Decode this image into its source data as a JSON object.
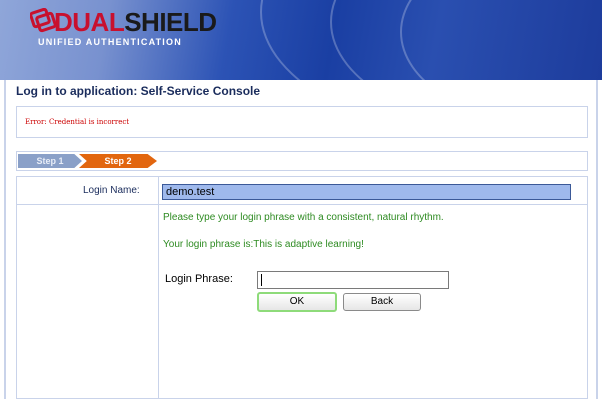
{
  "header": {
    "brand_red": "DUAL",
    "brand_dark": "SHIELD",
    "tagline": "UNIFIED AUTHENTICATION",
    "brand_color": "#c8102e"
  },
  "page_title": "Log in to application: Self-Service Console",
  "error": "Error: Credential is incorrect",
  "steps": [
    {
      "label": "Step 1",
      "state": "done"
    },
    {
      "label": "Step 2",
      "state": "active"
    }
  ],
  "form": {
    "login_name_label": "Login Name:",
    "login_name_value": "demo.test",
    "instruction": "Please type your login phrase with a consistent, natural rhythm.",
    "phrase_hint": "Your login phrase is:This is adaptive learning!",
    "phrase_label": "Login Phrase:",
    "phrase_value": "",
    "ok_label": "OK",
    "back_label": "Back"
  },
  "colors": {
    "accent_step": "#e2660f",
    "success_text": "#2e8b22",
    "error_text": "#cc0000"
  }
}
